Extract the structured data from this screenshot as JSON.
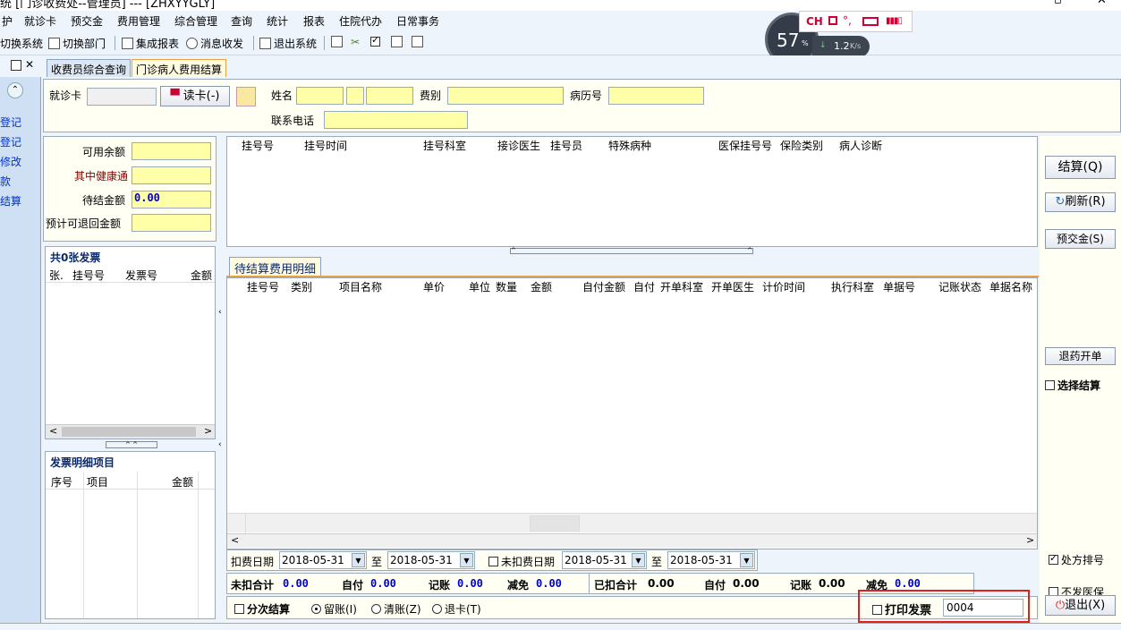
{
  "window": {
    "title": "统 [门诊收费处--管理员] --- [ZHXYYGLY]"
  },
  "menu": [
    "护",
    "就诊卡",
    "预交金",
    "费用管理",
    "综合管理",
    "查询",
    "统计",
    "报表",
    "住院代办",
    "日常事务"
  ],
  "toolbar": {
    "switch_system": "切换系统",
    "switch_dept": "切换部门",
    "report": "集成报表",
    "message": "消息收发",
    "exit_system": "退出系统"
  },
  "net_widget": {
    "percent": "57",
    "unit": "%",
    "speed": "1.2",
    "speed_unit": "K/s"
  },
  "ime": {
    "lang": "CH",
    "text": "°,"
  },
  "tabs": [
    "收费员综合查询",
    "门诊病人费用结算"
  ],
  "leftnav": [
    "登记",
    "登记",
    "修改",
    "款",
    "结算"
  ],
  "patient": {
    "card_label": "就诊卡",
    "read_card": "读卡(-)",
    "name_label": "姓名",
    "fee_type_label": "费别",
    "record_label": "病历号",
    "phone_label": "联系电话"
  },
  "balance": {
    "available_label": "可用余额",
    "health_label": "其中健康通",
    "pending_label": "待结金额",
    "pending_value": "0.00",
    "refund_label": "预计可退回金额"
  },
  "invoice": {
    "title": "共0张发票",
    "columns": [
      "张.",
      "挂号号",
      "发票号",
      "金额"
    ]
  },
  "invoice_detail": {
    "title": "发票明细项目",
    "columns": [
      "序号",
      "项目",
      "金额"
    ]
  },
  "reg_table": {
    "columns": [
      "挂号号",
      "挂号时间",
      "挂号科室",
      "接诊医生",
      "挂号员",
      "特殊病种",
      "医保挂号号",
      "保险类别",
      "病人诊断"
    ]
  },
  "detail": {
    "tab": "待结算费用明细",
    "columns": [
      "挂号号",
      "类别",
      "项目名称",
      "单价",
      "单位",
      "数量",
      "金额",
      "自付金额",
      "自付",
      "开单科室",
      "开单医生",
      "计价时间",
      "执行科室",
      "单据号",
      "记账状态",
      "单据名称"
    ]
  },
  "filters": {
    "deduct_label": "扣费日期",
    "deduct_from": "2018-05-31",
    "to1": "至",
    "deduct_to": "2018-05-31",
    "undeduct_label": "未扣费日期",
    "undeduct_from": "2018-05-31",
    "to2": "至",
    "undeduct_to": "2018-05-31"
  },
  "totals": {
    "undeducted_label": "未扣合计",
    "undeducted": "0.00",
    "self1_label": "自付",
    "self1": "0.00",
    "record1_label": "记账",
    "record1": "0.00",
    "reduce1_label": "减免",
    "reduce1": "0.00",
    "deducted_label": "已扣合计",
    "deducted": "0.00",
    "self2_label": "自付",
    "self2": "0.00",
    "record2_label": "记账",
    "record2": "0.00",
    "reduce2_label": "减免",
    "reduce2": "0.00"
  },
  "options": {
    "split": "分次结算",
    "keep": "留账(I)",
    "clear": "清账(Z)",
    "refund_card": "退卡(T)",
    "print_invoice": "打印发票",
    "invoice_no": "0004"
  },
  "right": {
    "settle": "结算(Q)",
    "refresh": "刷新(R)",
    "deposit": "预交金(S)",
    "return_drug": "退药开单",
    "select_settle": "选择结算",
    "rx_sort": "处方排号",
    "no_insurance": "不发医保",
    "exit": "退出(X)"
  }
}
